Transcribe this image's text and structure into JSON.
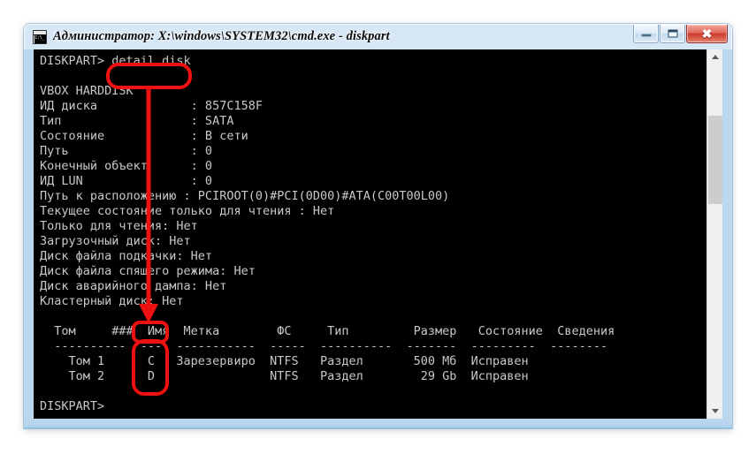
{
  "window": {
    "title": "Администратор: X:\\windows\\SYSTEM32\\cmd.exe - diskpart",
    "icon_name": "cmd-console-icon",
    "buttons": {
      "minimize_label": "–",
      "maximize_label": "□",
      "close_label": "✖"
    }
  },
  "console": {
    "prompt": "DISKPART>",
    "command": "detail disk",
    "lines": [
      "DISKPART> detail disk",
      "",
      "VBOX HARDDISK",
      "ИД диска             : 857C158F",
      "Тип                  : SATA",
      "Состояние            : В сети",
      "Путь                 : 0",
      "Конечный объект      : 0",
      "ИД LUN               : 0",
      "Путь к расположению : PCIROOT(0)#PCI(0D00)#ATA(C00T00L00)",
      "Текущее состояние только для чтения : Нет",
      "Только для чтения: Нет",
      "Загрузочный диск: Нет",
      "Диск файла подкачки: Нет",
      "Диск файла спящего режима: Нет",
      "Диск аварийного дампа: Нет",
      "Кластерный диск: Нет",
      "",
      "  Том     ###  Имя  Метка        ФС     Тип         Размер   Состояние  Сведения",
      "  ----------  ---  -----------  -----  ----------  -------  ---------  --------",
      "    Том 1      C   Зарезервиро  NTFS   Раздел       500 Мб  Исправен",
      "    Том 2      D                NTFS   Раздел        29 Gb  Исправен",
      "",
      "DISKPART>"
    ],
    "disk_info": {
      "model": "VBOX HARDDISK",
      "disk_id_label": "ИД диска",
      "disk_id_value": "857C158F",
      "type_label": "Тип",
      "type_value": "SATA",
      "state_label": "Состояние",
      "state_value": "В сети",
      "path_label": "Путь",
      "path_value": "0",
      "target_label": "Конечный объект",
      "target_value": "0",
      "lun_label": "ИД LUN",
      "lun_value": "0",
      "location_label": "Путь к расположению",
      "location_value": "PCIROOT(0)#PCI(0D00)#ATA(C00T00L00)",
      "current_readonly_label": "Текущее состояние только для чтения",
      "current_readonly_value": "Нет",
      "readonly_label": "Только для чтения",
      "readonly_value": "Нет",
      "boot_label": "Загрузочный диск",
      "boot_value": "Нет",
      "pagefile_label": "Диск файла подкачки",
      "pagefile_value": "Нет",
      "hiberfile_label": "Диск файла спящего режима",
      "hiberfile_value": "Нет",
      "crashdump_label": "Диск аварийного дампа",
      "crashdump_value": "Нет",
      "cluster_label": "Кластерный диск",
      "cluster_value": "Нет"
    },
    "volume_table": {
      "headers": [
        "Том",
        "###",
        "Имя",
        "Метка",
        "ФС",
        "Тип",
        "Размер",
        "Состояние",
        "Сведения"
      ],
      "rows": [
        {
          "volume": "Том 1",
          "number": "",
          "letter": "C",
          "label": "Зарезервиро",
          "fs": "NTFS",
          "type": "Раздел",
          "size": "500 Мб",
          "status": "Исправен",
          "info": ""
        },
        {
          "volume": "Том 2",
          "number": "",
          "letter": "D",
          "label": "",
          "fs": "NTFS",
          "type": "Раздел",
          "size": "29 Gb",
          "status": "Исправен",
          "info": ""
        }
      ]
    },
    "cursor_visible": true
  },
  "annotations": {
    "color": "#ee1111",
    "highlight_command": "detail disk",
    "highlight_header": "Имя",
    "highlight_column": "C / D",
    "arrow": "down-arrow-from-command-to-name-column"
  },
  "scrollbar": {
    "up_arrow": "scroll-up-arrow",
    "down_arrow": "scroll-down-arrow",
    "thumb": "scroll-thumb"
  },
  "colors": {
    "console_bg": "#000000",
    "console_fg": "#c8c8c8",
    "frame": "#bcd8ef",
    "annotation_red": "#ee1111"
  }
}
